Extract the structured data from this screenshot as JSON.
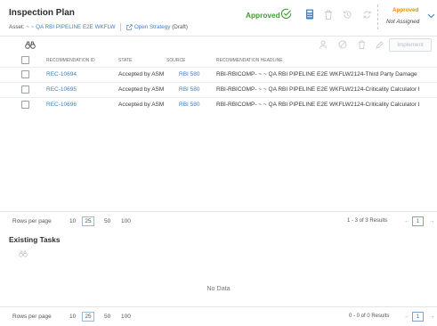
{
  "header": {
    "title": "Inspection Plan",
    "asset_label": "Asset:",
    "asset_name": "~ ~ QA RBI PIPELINE E2E WKFLW",
    "open_strategy": "Open Strategy",
    "draft": "(Draft)",
    "approved_label": "Approved",
    "status_state": "Approved",
    "status_assignee": "Not Assigned"
  },
  "icons": {
    "approve": "check-circle-icon",
    "calculator": "calculator-icon",
    "delete": "trash-icon",
    "history": "history-icon",
    "refresh": "refresh-icon",
    "dropdown": "chevron-down-icon",
    "open_external": "external-link-icon",
    "binoculars": "binoculars-icon",
    "user": "user-icon",
    "block": "block-icon",
    "edit": "pencil-icon"
  },
  "toolbar": {
    "implement_label": "Implement"
  },
  "table": {
    "columns": [
      "RECOMMENDATION ID",
      "STATE",
      "SOURCE",
      "RECOMMENDATION HEADLINE"
    ],
    "rows": [
      {
        "id": "REC-10694",
        "state": "Accepted by ASM",
        "source": "RBI 580",
        "headline": "RBI-RBICOMP- ~ ~ QA RBI PIPELINE E2E WKFLW2124-Third Party Damage"
      },
      {
        "id": "REC-10695",
        "state": "Accepted by ASM",
        "source": "RBI 580",
        "headline": "RBI-RBICOMP- ~ ~ QA RBI PIPELINE E2E WKFLW2124-Criticality Calculator I"
      },
      {
        "id": "REC-10696",
        "state": "Accepted by ASM",
        "source": "RBI 580",
        "headline": "RBI-RBICOMP- ~ ~ QA RBI PIPELINE E2E WKFLW2124-Criticality Calculator I"
      }
    ]
  },
  "pager1": {
    "rows_label": "Rows per page",
    "options": [
      "10",
      "25",
      "50",
      "100"
    ],
    "selected": "25",
    "results": "1 - 3 of 3 Results",
    "page": "1"
  },
  "tasks": {
    "title": "Existing Tasks",
    "no_data": "No Data"
  },
  "pager2": {
    "rows_label": "Rows per page",
    "options": [
      "10",
      "25",
      "50",
      "100"
    ],
    "selected": "25",
    "results": "0 - 0 of 0 Results",
    "page": "1"
  },
  "colors": {
    "link": "#3f7fc4",
    "approved_green": "#3f9c35",
    "status_orange": "#e58a1b",
    "disabled": "#b8bcc2"
  }
}
